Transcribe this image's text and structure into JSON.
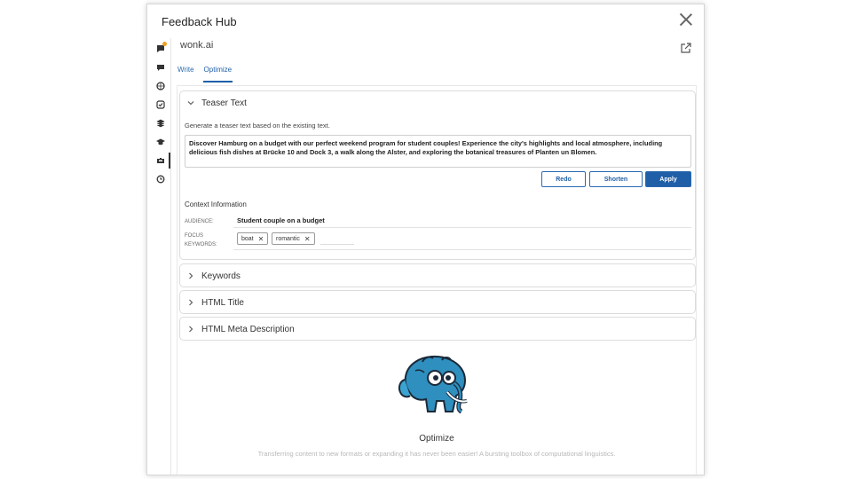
{
  "window": {
    "title": "Feedback Hub"
  },
  "app": {
    "name": "wonk.ai"
  },
  "tabs": [
    {
      "label": "Write"
    },
    {
      "label": "Optimize"
    }
  ],
  "rail_icons": [
    "feedback-icon",
    "chat-icon",
    "globe-icon",
    "checklist-icon",
    "layers-icon",
    "graduation-cap-icon",
    "wonk-icon",
    "timer-icon"
  ],
  "teaser": {
    "title": "Teaser Text",
    "description": "Generate a teaser text based on the existing text.",
    "text": "Discover Hamburg on a budget with our perfect weekend program for student couples! Experience the city's highlights and local atmosphere, including delicious fish dishes at Brücke 10 and Dock 3, a walk along the Alster, and exploring the botanical treasures of Planten un Blomen.",
    "buttons": {
      "redo": "Redo",
      "shorten": "Shorten",
      "apply": "Apply"
    },
    "context": {
      "title": "Context Information",
      "audience_label": "AUDIENCE:",
      "audience_value": "Student couple on a budget",
      "focus_label_1": "FOCUS",
      "focus_label_2": "KEYWORDS:",
      "keywords": [
        "boat",
        "romantic"
      ]
    }
  },
  "sections": [
    {
      "title": "Keywords"
    },
    {
      "title": "HTML Title"
    },
    {
      "title": "HTML Meta Description"
    }
  ],
  "empty_state": {
    "title": "Optimize",
    "description": "Transferring content to new formats or expanding it has never been easier! A bursting toolbox of computational linguistics."
  },
  "colors": {
    "accent": "#1f5fa8",
    "notification": "#f0a020"
  }
}
